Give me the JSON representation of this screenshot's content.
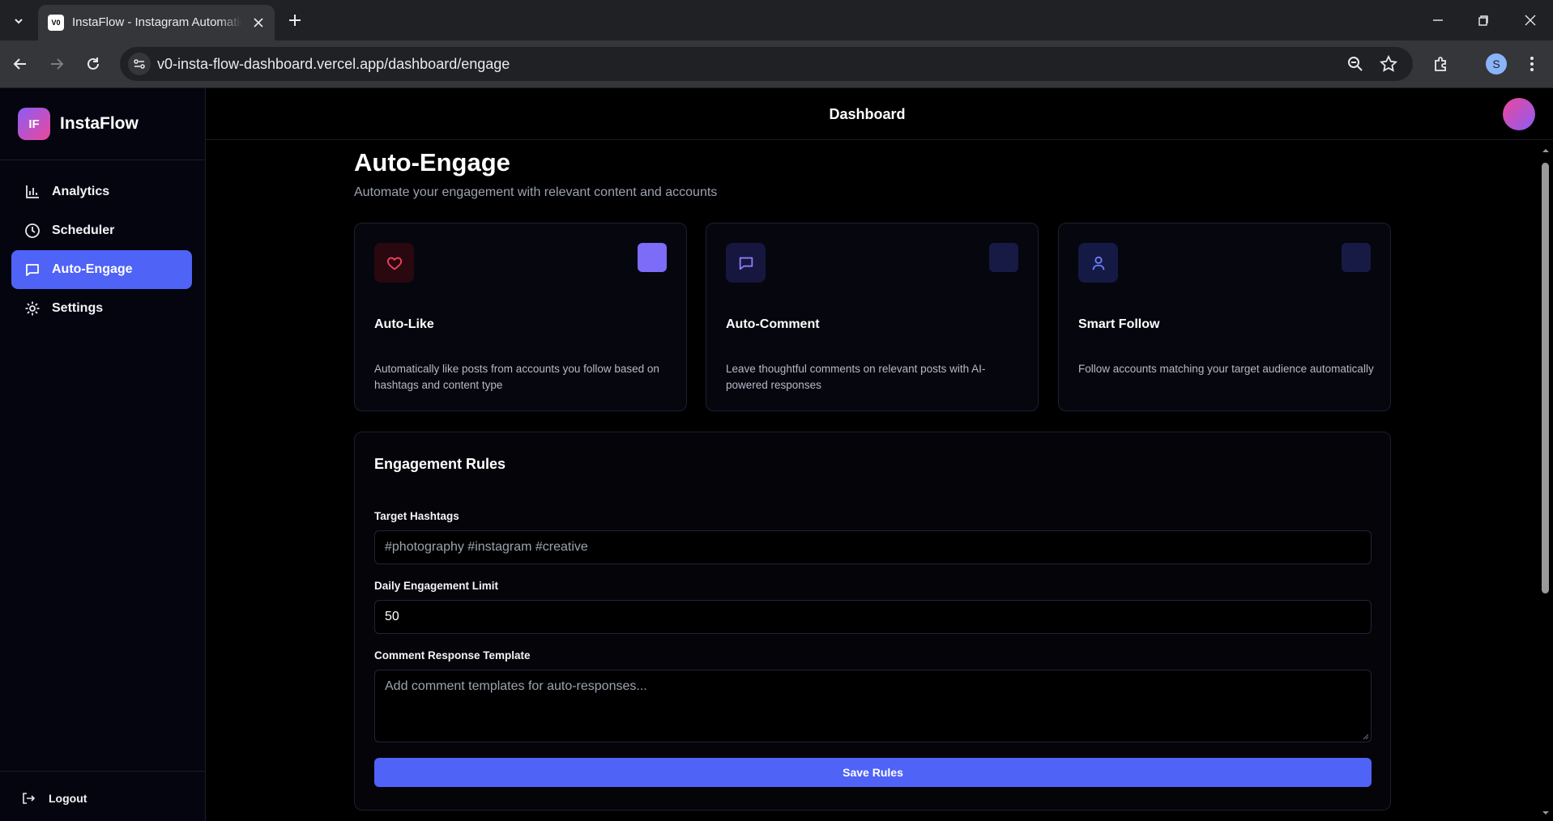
{
  "browser": {
    "tab_title": "InstaFlow - Instagram Automation Dashboard",
    "favicon_text": "V0",
    "url": "v0-insta-flow-dashboard.vercel.app/dashboard/engage",
    "profile_initial": "S"
  },
  "sidebar": {
    "logo_text": "IF",
    "brand": "InstaFlow",
    "items": [
      {
        "label": "Analytics",
        "icon": "bar-chart-icon"
      },
      {
        "label": "Scheduler",
        "icon": "clock-icon"
      },
      {
        "label": "Auto-Engage",
        "icon": "message-square-icon",
        "active": true
      },
      {
        "label": "Settings",
        "icon": "gear-icon"
      }
    ],
    "logout": "Logout"
  },
  "header": {
    "title": "Dashboard"
  },
  "page": {
    "title": "Auto-Engage",
    "subtitle": "Automate your engagement with relevant content and accounts"
  },
  "cards": [
    {
      "title": "Auto-Like",
      "description": "Automatically like posts from accounts you follow based on hashtags and content type",
      "icon": "heart-icon",
      "enabled": true
    },
    {
      "title": "Auto-Comment",
      "description": "Leave thoughtful comments on relevant posts with AI-powered responses",
      "icon": "message-square-icon",
      "enabled": false
    },
    {
      "title": "Smart Follow",
      "description": "Follow accounts matching your target audience automatically",
      "icon": "user-icon",
      "enabled": false
    }
  ],
  "rules": {
    "title": "Engagement Rules",
    "hashtags_label": "Target Hashtags",
    "hashtags_placeholder": "#photography #instagram #creative",
    "limit_label": "Daily Engagement Limit",
    "limit_value": "50",
    "template_label": "Comment Response Template",
    "template_placeholder": "Add comment templates for auto-responses...",
    "save_label": "Save Rules"
  },
  "colors": {
    "accent": "#4f63f7",
    "toggle_on": "#7c6cf7",
    "toggle_off": "#171a45"
  }
}
